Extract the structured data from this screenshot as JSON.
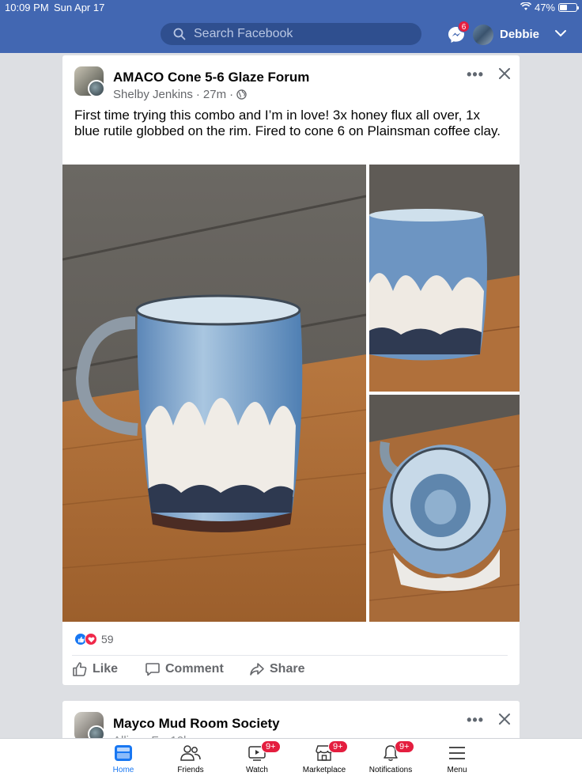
{
  "status_bar": {
    "time": "10:09 PM",
    "date": "Sun Apr 17",
    "battery": "47%",
    "battery_level": 0.47
  },
  "header": {
    "search_placeholder": "Search Facebook",
    "messenger_badge": "6",
    "user_name": "Debbie",
    "brand_color": "#4267b2"
  },
  "post1": {
    "group_name": "AMACO Cone 5-6 Glaze Forum",
    "author": "Shelby Jenkins",
    "time": "27m",
    "separator": "·",
    "more_label": "•••",
    "text": "First time trying this combo and I’m in love! 3x honey flux all over, 1x blue rutile globbed on the rim. Fired to cone 6 on Plainsman coffee clay.",
    "reaction_count": "59",
    "actions": {
      "like": "Like",
      "comment": "Comment",
      "share": "Share"
    }
  },
  "post2": {
    "group_name": "Mayco Mud Room Society",
    "author": "Allison F...",
    "time": "10h",
    "more_label": "•••"
  },
  "bottom_nav": {
    "home": "Home",
    "friends": "Friends",
    "watch": "Watch",
    "watch_badge": "9+",
    "marketplace": "Marketplace",
    "marketplace_badge": "9+",
    "notifications": "Notifications",
    "notifications_badge": "9+",
    "menu": "Menu",
    "active_color": "#1877f2"
  }
}
